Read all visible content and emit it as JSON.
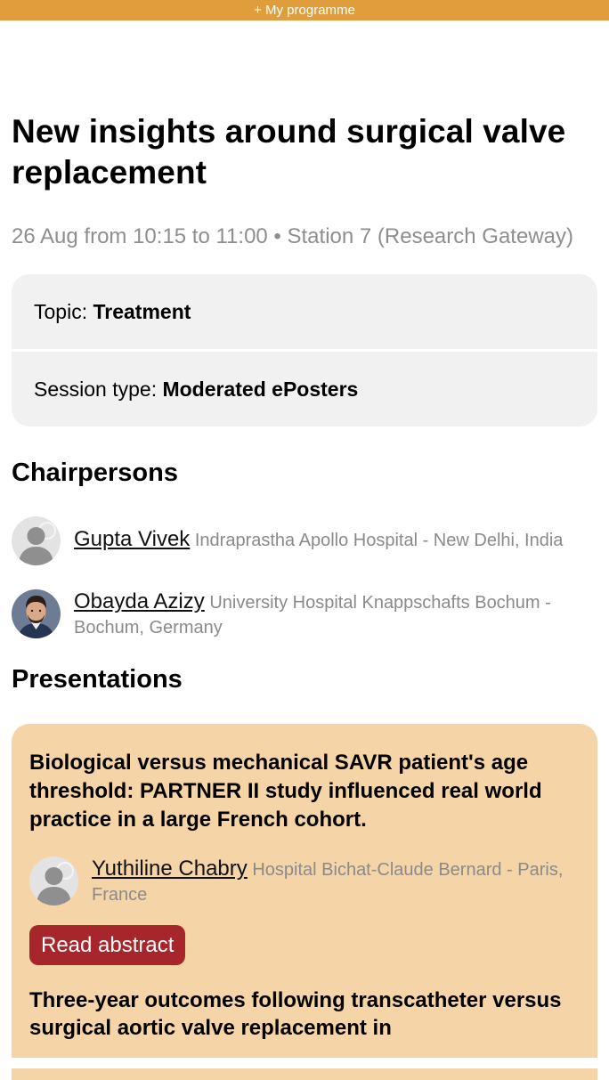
{
  "top_bar": {
    "label": "+ My programme"
  },
  "session": {
    "title": "New insights around surgical valve replacement",
    "meta": "26 Aug from 10:15 to 11:00 • Station 7 (Research Gateway)",
    "topic_label": "Topic: ",
    "topic_value": "Treatment",
    "type_label": "Session type: ",
    "type_value": "Moderated ePosters"
  },
  "chairpersons": {
    "heading": "Chairpersons",
    "items": [
      {
        "name": "Gupta Vivek",
        "affiliation": "Indraprastha Apollo Hospital - New Delhi, India",
        "avatar": "placeholder-avatar-icon"
      },
      {
        "name": "Obayda Azizy",
        "affiliation": "University Hospital Knappschafts Bochum - Bochum, Germany",
        "avatar": "photo-avatar"
      }
    ]
  },
  "presentations": {
    "heading": "Presentations",
    "items": [
      {
        "title": "Biological versus mechanical SAVR patient's age threshold: PARTNER II study influenced real world practice in a large French cohort.",
        "presenter_name": "Yuthiline Chabry",
        "presenter_affiliation": "Hospital Bichat-Claude Bernard - Paris, France",
        "button_label": "Read abstract"
      },
      {
        "title": "Three-year outcomes following transcatheter versus surgical aortic valve replacement in"
      }
    ]
  },
  "colors": {
    "top_bar": "#e09d3c",
    "card_background": "#f5d5a7",
    "info_box": "#f1f1f1",
    "button": "#a6262c",
    "muted_text": "#8e8e8e"
  }
}
